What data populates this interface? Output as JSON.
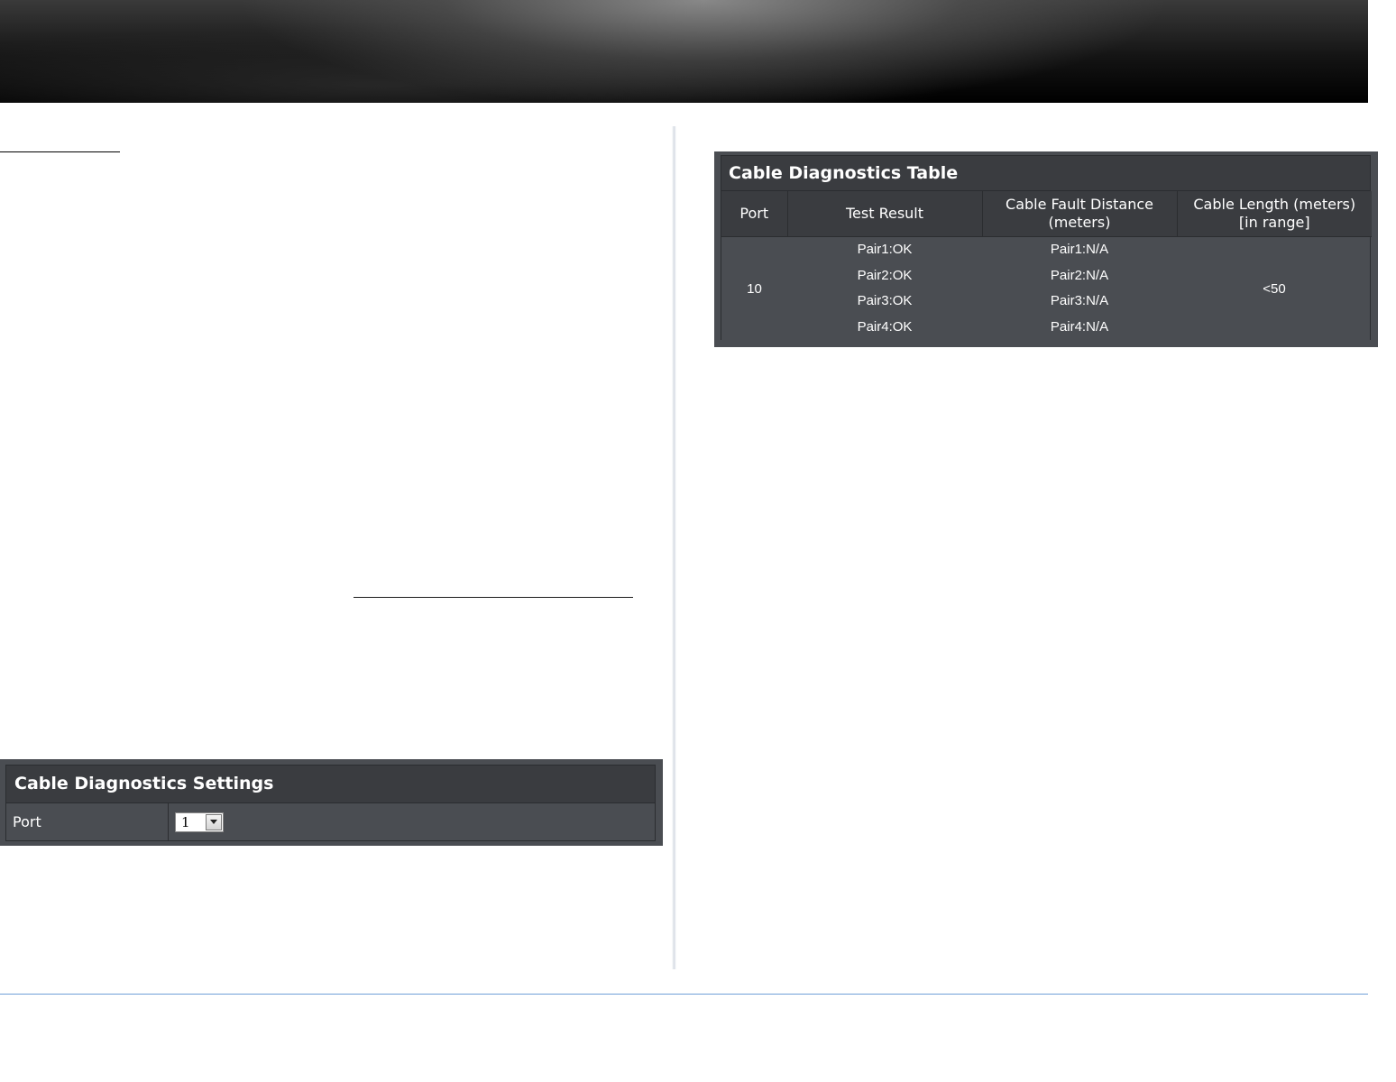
{
  "settings_panel": {
    "title": "Cable Diagnostics Settings",
    "port_label": "Port",
    "port_selected": "1"
  },
  "diagnostics_table": {
    "title": "Cable Diagnostics Table",
    "columns": {
      "port": "Port",
      "test_result": "Test Result",
      "fault_distance_line1": "Cable Fault Distance",
      "fault_distance_line2": "(meters)",
      "cable_length_line1": "Cable Length (meters)",
      "cable_length_line2": "[in range]"
    },
    "row": {
      "port": "10",
      "test_results": [
        "Pair1:OK",
        "Pair2:OK",
        "Pair3:OK",
        "Pair4:OK"
      ],
      "fault_distances": [
        "Pair1:N/A",
        "Pair2:N/A",
        "Pair3:N/A",
        "Pair4:N/A"
      ],
      "cable_length": "<50"
    }
  },
  "colors": {
    "panel_bg": "#4a4d52",
    "header_bg": "#3a3c40",
    "footer_rule": "#6f9fd8"
  }
}
